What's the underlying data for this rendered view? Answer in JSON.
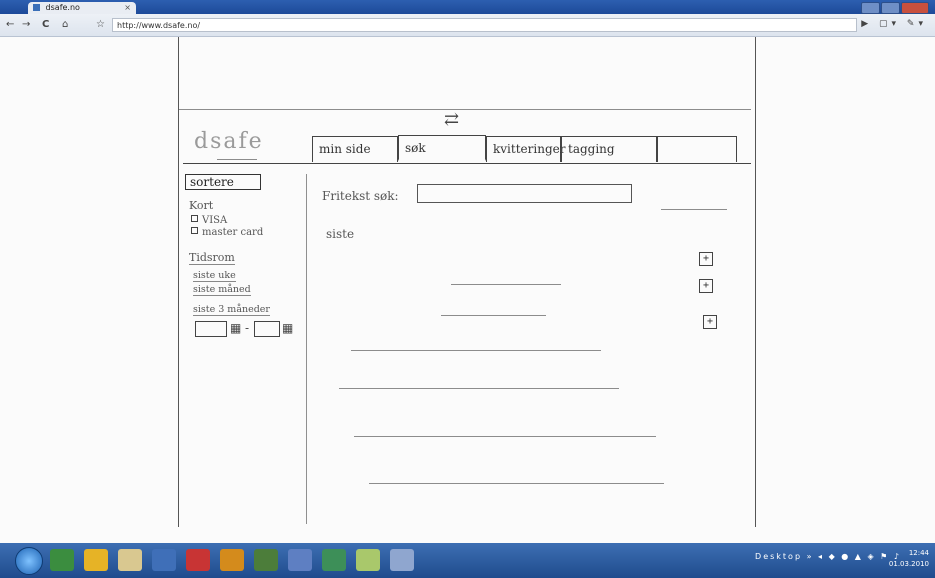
{
  "browser": {
    "tab_title": "dsafe.no",
    "tab_close": "×",
    "url": "http://www.dsafe.no/",
    "nav": {
      "back": "←",
      "forward": "→",
      "reload": "C",
      "home": "⌂",
      "star": "☆"
    },
    "right_icons": "▶ ▢▾ ✎▾"
  },
  "sketch": {
    "logo": "dsafe",
    "nav_tabs": [
      "min side",
      "søk",
      "kvitteringer",
      "tagging"
    ],
    "sort_button": "sortere",
    "card_heading": "Kort",
    "card_options": [
      "VISA",
      "master card"
    ],
    "period_heading": "Tidsrom",
    "period_links": [
      "siste uke",
      "siste måned",
      "siste 3 måneder"
    ],
    "search_label": "Fritekst søk:",
    "search_value": "",
    "recent_label": "siste",
    "expand_buttons": [
      "+",
      "+",
      "+"
    ],
    "date_separator": "-"
  },
  "taskbar": {
    "desktop_label": "Desktop",
    "clock_time": "12:44",
    "clock_date": "01.03.2010"
  },
  "colors": {
    "taskbar": "#1f4b8d",
    "titlebar": "#2d5fb0",
    "pencil": "#4b4b4b"
  }
}
